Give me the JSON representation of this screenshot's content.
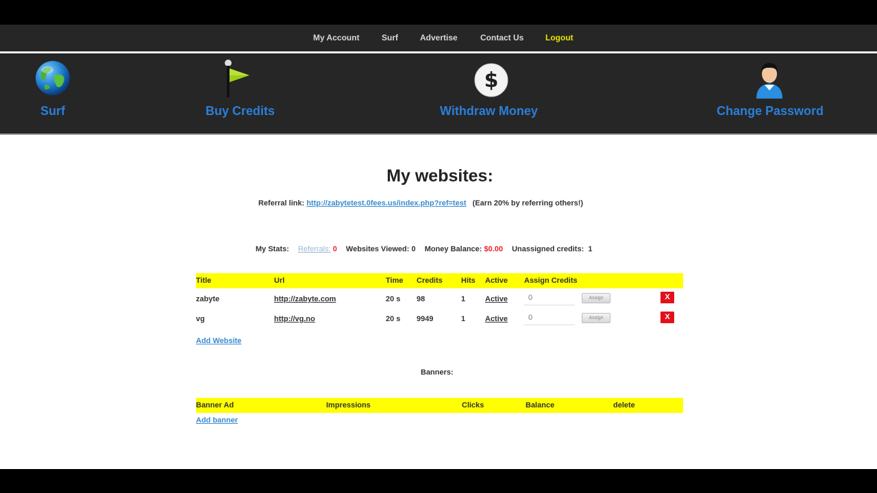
{
  "nav": {
    "items": [
      {
        "label": "My Account"
      },
      {
        "label": "Surf"
      },
      {
        "label": "Advertise"
      },
      {
        "label": "Contact Us"
      },
      {
        "label": "Logout"
      }
    ]
  },
  "quicklinks": [
    {
      "label": "Surf",
      "icon": "globe-icon"
    },
    {
      "label": "Buy Credits",
      "icon": "flag-icon"
    },
    {
      "label": "Withdraw Money",
      "icon": "dollar-icon"
    },
    {
      "label": "Change Password",
      "icon": "user-icon"
    }
  ],
  "page": {
    "title": "My websites:",
    "referral_label": "Referral link:",
    "referral_url": "http://zabytetest.0fees.us/index.php?ref=test",
    "referral_note": "(Earn 20% by referring others!)"
  },
  "stats": {
    "label": "My Stats:",
    "referrals_label": "Referrals:",
    "referrals_value": "0",
    "websites_viewed_label": "Websites Viewed:",
    "websites_viewed_value": "0",
    "money_balance_label": "Money Balance:",
    "money_balance_value": "$0.00",
    "unassigned_label": "Unassigned credits:",
    "unassigned_value": "1"
  },
  "websites_table": {
    "columns": [
      "Title",
      "Url",
      "Time",
      "Credits",
      "Hits",
      "Active",
      "Assign Credits"
    ],
    "rows": [
      {
        "title": "zabyte",
        "url": "http://zabyte.com",
        "time": "20 s",
        "credits": "98",
        "hits": "1",
        "active": "Active",
        "assign_value": "0",
        "assign_button": "Assign",
        "delete": "X"
      },
      {
        "title": "vg",
        "url": "http://vg.no",
        "time": "20 s",
        "credits": "9949",
        "hits": "1",
        "active": "Active",
        "assign_value": "0",
        "assign_button": "Assign",
        "delete": "X"
      }
    ],
    "add_link": "Add Website"
  },
  "banners": {
    "label": "Banners:",
    "columns": [
      "Banner Ad",
      "Impressions",
      "Clicks",
      "Balance",
      "delete"
    ],
    "add_link": "Add banner"
  },
  "colors": {
    "accent_blue": "#2b7fd9",
    "header_yellow": "#ffff00",
    "danger_red": "#e3101a",
    "active_green": "#1e9a2a",
    "logout_yellow": "#e6e600"
  }
}
